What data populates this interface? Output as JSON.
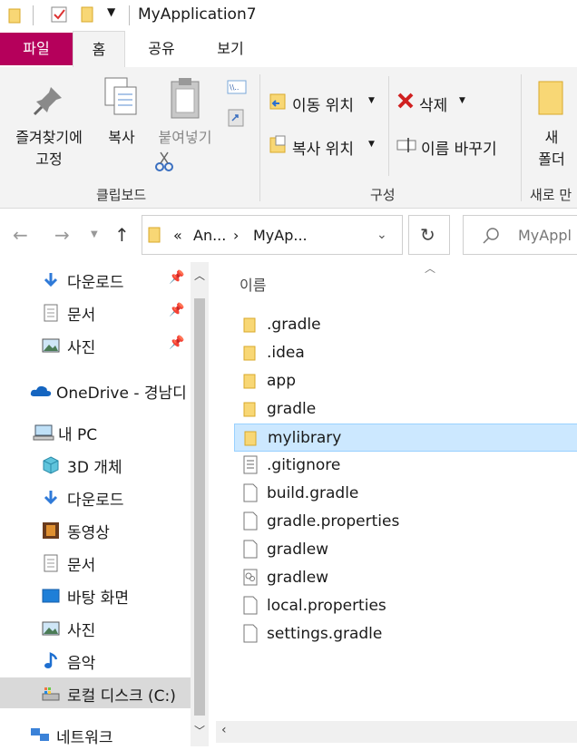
{
  "window": {
    "title": "MyApplication7"
  },
  "ribbon_tabs": [
    "파일",
    "홈",
    "공유",
    "보기"
  ],
  "ribbon": {
    "clipboard": {
      "pin_label_1": "즐겨찾기에",
      "pin_label_2": "고정",
      "copy": "복사",
      "paste": "붙여넣기",
      "group": "클립보드"
    },
    "organize": {
      "move_to": "이동 위치",
      "copy_to": "복사 위치",
      "delete": "삭제",
      "rename": "이름 바꾸기",
      "group": "구성"
    },
    "new": {
      "new_label_1": "새",
      "new_label_2": "폴더",
      "group": "새로 만"
    }
  },
  "address": {
    "crumb_overflow": "«",
    "crumb_1": "An...",
    "crumb_2": "MyAp...",
    "search_placeholder": "MyAppl"
  },
  "nav": {
    "quick_access": [
      {
        "label": "다운로드",
        "icon": "download-arrow-icon"
      },
      {
        "label": "문서",
        "icon": "document-icon"
      },
      {
        "label": "사진",
        "icon": "pictures-icon"
      }
    ],
    "onedrive": "OneDrive - 경남디",
    "this_pc": "내 PC",
    "pc_items": [
      {
        "label": "3D 개체",
        "icon": "3d-objects-icon"
      },
      {
        "label": "다운로드",
        "icon": "download-arrow-icon"
      },
      {
        "label": "동영상",
        "icon": "videos-icon"
      },
      {
        "label": "문서",
        "icon": "document-icon"
      },
      {
        "label": "바탕 화면",
        "icon": "desktop-icon"
      },
      {
        "label": "사진",
        "icon": "pictures-icon"
      },
      {
        "label": "음악",
        "icon": "music-icon"
      },
      {
        "label": "로컬 디스크 (C:)",
        "icon": "drive-icon"
      }
    ],
    "network": "네트워크"
  },
  "content": {
    "column_name": "이름",
    "files": [
      {
        "name": ".gradle",
        "type": "folder"
      },
      {
        "name": ".idea",
        "type": "folder"
      },
      {
        "name": "app",
        "type": "folder"
      },
      {
        "name": "gradle",
        "type": "folder"
      },
      {
        "name": "mylibrary",
        "type": "folder",
        "selected": true
      },
      {
        "name": ".gitignore",
        "type": "text"
      },
      {
        "name": "build.gradle",
        "type": "file"
      },
      {
        "name": "gradle.properties",
        "type": "file"
      },
      {
        "name": "gradlew",
        "type": "file"
      },
      {
        "name": "gradlew",
        "type": "script"
      },
      {
        "name": "local.properties",
        "type": "file"
      },
      {
        "name": "settings.gradle",
        "type": "file"
      }
    ]
  },
  "colors": {
    "file_tab": "#b5005b",
    "folder": "#f8d775",
    "selection": "#cce8ff"
  }
}
